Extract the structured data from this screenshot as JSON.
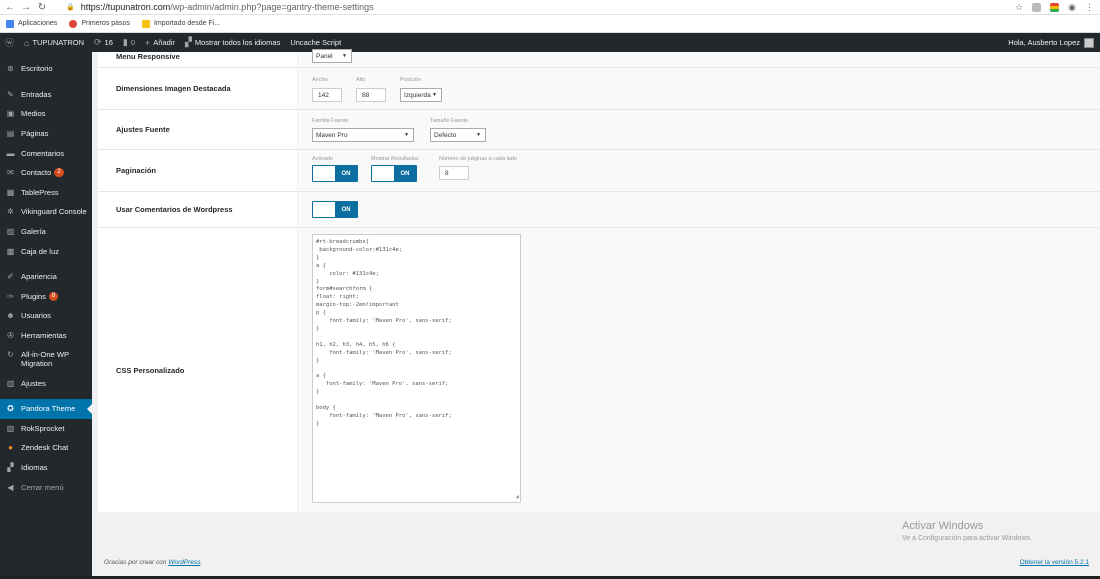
{
  "browser": {
    "url_host": "https://tupunatron.com",
    "url_path": "/wp-admin/admin.php?page=gantry-theme-settings",
    "bookmarks": [
      {
        "label": "Aplicaciones",
        "color": "#4285f4"
      },
      {
        "label": "Primeros pasos",
        "color": "#db4437"
      },
      {
        "label": "Importado desde Fi...",
        "color": "#f4c20d"
      }
    ]
  },
  "adminbar": {
    "site": "TUPUNATRON",
    "updates": "16",
    "comments": "0",
    "add_new": "Añadir",
    "languages": "Mostrar todos los idiomas",
    "uncache": "Uncache Script",
    "greeting": "Hola, Ausberto Lopez"
  },
  "sidebar": {
    "items": [
      {
        "label": "Escritorio",
        "icon": "dashboard-icon",
        "glyph": "⊛"
      },
      {
        "label": "Entradas",
        "icon": "pin-icon",
        "glyph": "✎"
      },
      {
        "label": "Medios",
        "icon": "media-icon",
        "glyph": "▣"
      },
      {
        "label": "Páginas",
        "icon": "pages-icon",
        "glyph": "▤"
      },
      {
        "label": "Comentarios",
        "icon": "comments-icon",
        "glyph": "▬"
      },
      {
        "label": "Contacto",
        "icon": "mail-icon",
        "glyph": "✉",
        "badge": "2"
      },
      {
        "label": "TablePress",
        "icon": "table-icon",
        "glyph": "▦"
      },
      {
        "label": "Vikinguard Console",
        "icon": "gear-icon",
        "glyph": "✲"
      },
      {
        "label": "Galería",
        "icon": "gallery-icon",
        "glyph": "▨"
      },
      {
        "label": "Caja de luz",
        "icon": "lightbox-icon",
        "glyph": "▩"
      },
      {
        "label": "Apariencia",
        "icon": "brush-icon",
        "glyph": "✐"
      },
      {
        "label": "Plugins",
        "icon": "plugin-icon",
        "glyph": "✑",
        "badge": "8"
      },
      {
        "label": "Usuarios",
        "icon": "users-icon",
        "glyph": "☻"
      },
      {
        "label": "Herramientas",
        "icon": "wrench-icon",
        "glyph": "✇"
      },
      {
        "label": "All-in-One WP Migration",
        "icon": "migration-icon",
        "glyph": "↻"
      },
      {
        "label": "Ajustes",
        "icon": "settings-icon",
        "glyph": "▥"
      },
      {
        "label": "Pandora Theme",
        "icon": "theme-icon",
        "glyph": "✪"
      },
      {
        "label": "RokSprocket",
        "icon": "roksprocket-icon",
        "glyph": "▧"
      },
      {
        "label": "Zendesk Chat",
        "icon": "chat-icon",
        "glyph": "●"
      },
      {
        "label": "Idiomas",
        "icon": "translate-icon",
        "glyph": "▞"
      },
      {
        "label": "Cerrar menú",
        "icon": "collapse-icon",
        "glyph": "◀"
      }
    ]
  },
  "settings": {
    "responsive": {
      "label": "Menu Responsive",
      "select": "Panel"
    },
    "image": {
      "label": "Dimensiones Imagen Destacada",
      "width_lbl": "Ancho",
      "width_val": "142",
      "height_lbl": "Alto",
      "height_val": "88",
      "pos_lbl": "Posición",
      "pos_val": "Izquierda"
    },
    "font": {
      "label": "Ajustes Fuente",
      "family_lbl": "Familia Fuente",
      "family_val": "Maven Pro",
      "size_lbl": "Tamaño Fuente",
      "size_val": "Defecto"
    },
    "pagination": {
      "label": "Paginación",
      "enabled_lbl": "Activado",
      "results_lbl": "Mostrar Resultados",
      "pages_lbl": "Número de páginas a cada lado",
      "pages_val": "8",
      "on": "ON"
    },
    "wpcomments": {
      "label": "Usar Comentarios de Wordpress",
      "on": "ON"
    },
    "css": {
      "label": "CSS Personalizado",
      "code": "#rt-breadcrumbs{\n background-color:#131c4e;\n}\na {\n    color: #131c4e;\n}\nform#searchform {\nfloat: right;\nmargin-top:-2em!important\np {\n    font-family: 'Maven Pro', sans-serif;\n}\n\nh1, h2, h3, h4, h5, h6 {\n    font-family: 'Maven Pro', sans-serif;\n}\n\na {\n   font-family: 'Maven Pro', sans-serif;\n}\n\nbody {\n    font-family: 'Maven Pro', sans-serif;\n}"
    }
  },
  "watermark": {
    "line1": "Activar Windows",
    "line2": "Ve a Configuración para activar Windows."
  },
  "footer": {
    "thanks_prefix": "Gracias por crear con ",
    "thanks_link": "WordPress",
    "thanks_suffix": ".",
    "version": "Obtener la versión 5.2.1"
  }
}
